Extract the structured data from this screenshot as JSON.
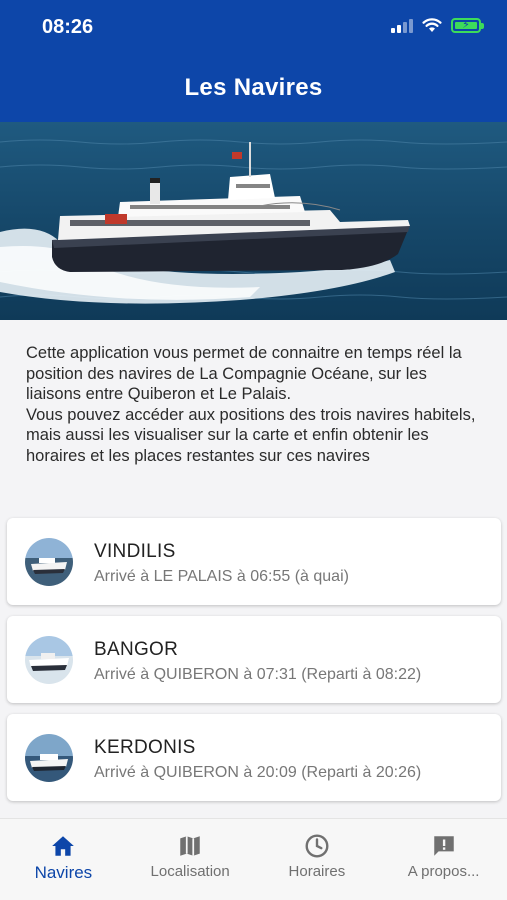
{
  "status_bar": {
    "time": "08:26"
  },
  "header": {
    "title": "Les Navires"
  },
  "intro": {
    "text": "Cette application vous permet de connaitre en temps réel la position des navires de La Compagnie Océane, sur les liaisons entre Quiberon et Le Palais.\nVous pouvez accéder aux positions des trois navires habitels, mais aussi les visualiser sur la carte et enfin obtenir les horaires et les places restantes sur ces navires"
  },
  "ships": [
    {
      "name": "VINDILIS",
      "status": "Arrivé à LE PALAIS à 06:55 (à quai)"
    },
    {
      "name": "BANGOR",
      "status": "Arrivé à QUIBERON à 07:31 (Reparti à 08:22)"
    },
    {
      "name": "KERDONIS",
      "status": "Arrivé à QUIBERON à 20:09 (Reparti à 20:26)"
    }
  ],
  "tabs": [
    {
      "label": "Navires",
      "icon": "home-icon",
      "active": true
    },
    {
      "label": "Localisation",
      "icon": "map-icon",
      "active": false
    },
    {
      "label": "Horaires",
      "icon": "clock-icon",
      "active": false
    },
    {
      "label": "A propos...",
      "icon": "alert-message-icon",
      "active": false
    }
  ],
  "colors": {
    "primary": "#0d46a9",
    "background": "#f4f4f6",
    "battery": "#3ddc5a"
  }
}
